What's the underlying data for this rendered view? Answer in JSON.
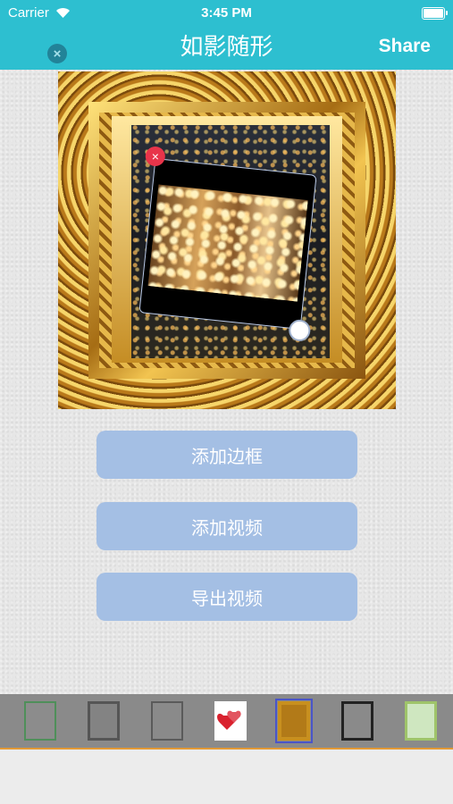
{
  "status_bar": {
    "carrier": "Carrier",
    "time": "3:45 PM"
  },
  "nav": {
    "title": "如影随形",
    "share_label": "Share",
    "close_symbol": "×"
  },
  "sticker": {
    "delete_symbol": "×"
  },
  "actions": {
    "add_frame": "添加边框",
    "add_video": "添加视频",
    "export_video": "导出视频"
  },
  "picker": {
    "frames": [
      {
        "name": "frame-thumb-green-corners",
        "selected": false
      },
      {
        "name": "frame-thumb-gray-grunge",
        "selected": false
      },
      {
        "name": "frame-thumb-gray-plain",
        "selected": false
      },
      {
        "name": "frame-thumb-hearts",
        "selected": false
      },
      {
        "name": "frame-thumb-gold-ornate",
        "selected": true
      },
      {
        "name": "frame-thumb-black-grunge",
        "selected": false
      },
      {
        "name": "frame-thumb-floral-vine",
        "selected": false
      }
    ]
  },
  "colors": {
    "header": "#2dbfd0",
    "button": "#a4bfe4",
    "picker": "#8a8a8a",
    "picker_accent": "#e39a35",
    "delete": "#e8344a"
  }
}
